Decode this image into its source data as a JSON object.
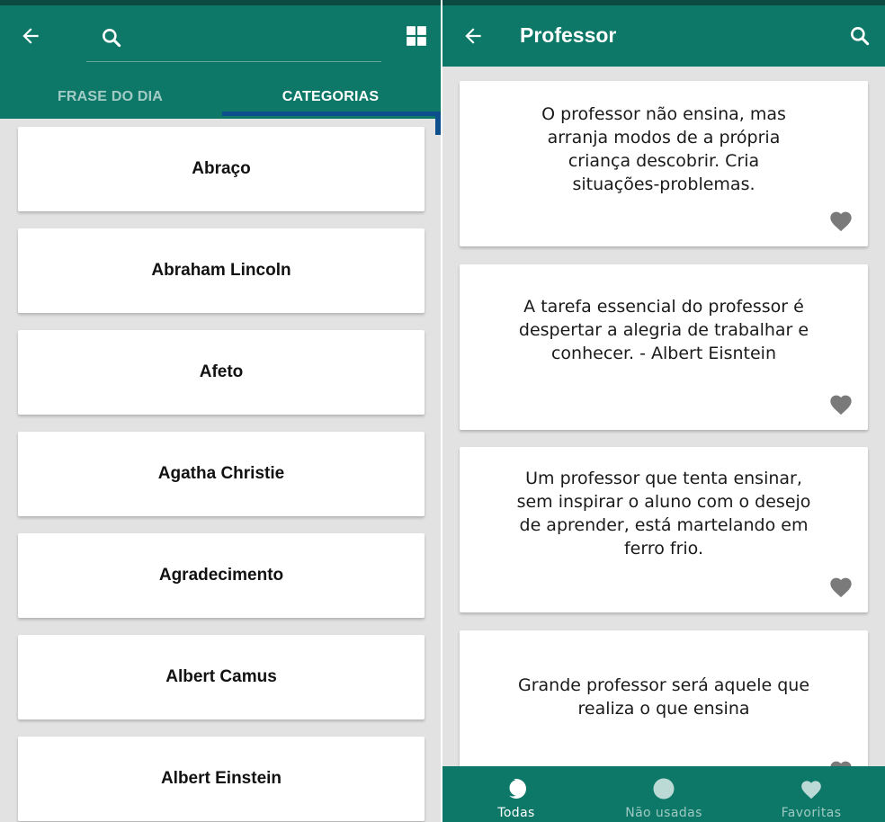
{
  "left_screen": {
    "tabs": [
      {
        "label": "FRASE DO DIA",
        "active": false
      },
      {
        "label": "CATEGORIAS",
        "active": true
      }
    ],
    "icons": {
      "back": "arrow-back-icon",
      "search": "search-icon",
      "grid": "grid-view-icon"
    },
    "categories": [
      "Abraço",
      "Abraham Lincoln",
      "Afeto",
      "Agatha Christie",
      "Agradecimento",
      "Albert Camus",
      "Albert Einstein"
    ]
  },
  "right_screen": {
    "title": "Professor",
    "icons": {
      "back": "arrow-back-icon",
      "search": "search-icon",
      "favorite": "heart-icon"
    },
    "quotes": [
      {
        "lines": [
          "O professor não ensina, mas",
          "arranja modos de a própria",
          "criança descobrir. Cria",
          "situações-problemas."
        ]
      },
      {
        "lines": [
          "A tarefa essencial do professor é",
          "despertar a alegria de trabalhar e",
          "conhecer. - Albert Eisntein"
        ]
      },
      {
        "lines": [
          "Um professor que tenta ensinar,",
          "sem inspirar o aluno com o desejo",
          "de aprender, está martelando em",
          "ferro frio."
        ]
      },
      {
        "lines": [
          "Grande professor será aquele que",
          "realiza o que ensina"
        ]
      }
    ],
    "bottom_nav": [
      {
        "label": "Todas",
        "icon": "crescent-icon",
        "active": true
      },
      {
        "label": "Não usadas",
        "icon": "circle-icon",
        "active": false
      },
      {
        "label": "Favoritas",
        "icon": "heart-icon",
        "active": false
      }
    ]
  },
  "colors": {
    "primary": "#0d7868",
    "status_bar": "#0b4a40",
    "tab_indicator": "#0d4f8c",
    "background": "#e2e2e2",
    "heart": "#7a7a7a"
  }
}
